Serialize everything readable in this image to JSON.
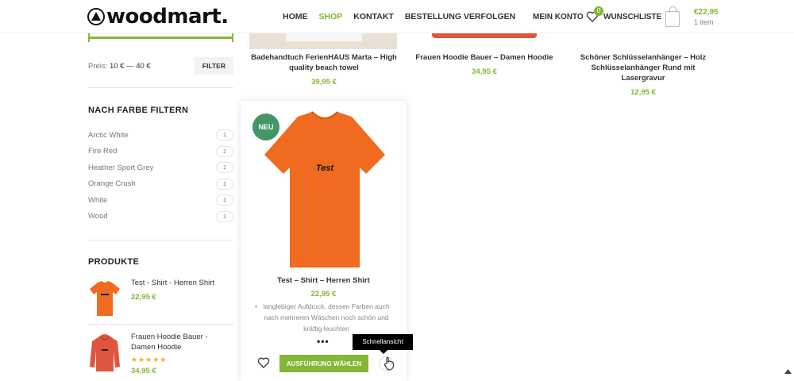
{
  "header": {
    "logo_text": "woodmart.",
    "nav": [
      "HOME",
      "SHOP",
      "KONTAKT",
      "BESTELLUNG VERFOLGEN"
    ],
    "active_nav": "SHOP",
    "my_account": "MEIN KONTO",
    "wishlist_count": "0",
    "wishlist_label": "WUNSCHLISTE",
    "cart_total": "€22,95",
    "cart_items": "1 item"
  },
  "sidebar": {
    "price_prefix": "Preis:",
    "price_range": "10 € — 40 €",
    "filter_button": "FILTER",
    "color_heading": "NACH FARBE FILTERN",
    "colors": [
      {
        "name": "Arctic White",
        "count": "1"
      },
      {
        "name": "Fire Red",
        "count": "1"
      },
      {
        "name": "Heather Sport Grey",
        "count": "1"
      },
      {
        "name": "Orange Crush",
        "count": "1"
      },
      {
        "name": "White",
        "count": "1"
      },
      {
        "name": "Wood",
        "count": "1"
      }
    ],
    "products_heading": "PRODUKTE",
    "products": [
      {
        "title": "Test - Shirt - Herren Shirt",
        "price": "22,95 €"
      },
      {
        "title": "Frauen Hoodie Bauer - Damen Hoodie",
        "price": "34,95 €",
        "stars": "★★★★★"
      }
    ]
  },
  "top_products": [
    {
      "title": "Badehandtuch FerienHAUS Marta – High quality beach towel",
      "price": "39,95 €"
    },
    {
      "title": "Frauen Hoodie Bauer – Damen Hoodie",
      "price": "34,95 €"
    },
    {
      "title": "Schöner Schlüsselanhänger – Holz Schlüsselanhänger Rund mit Lasergravur",
      "price": "12,95 €"
    }
  ],
  "featured": {
    "badge": "NEU",
    "shirt_print": "Test",
    "title": "Test – Shirt – Herren Shirt",
    "price": "22,95 €",
    "description": "langlebiger Aufdruck, dessen Farben auch nach mehreren Wäschen noch schön und kräftig leuchten",
    "dots": "•••",
    "add_button": "AUSFÜHRUNG WÄHLEN",
    "tooltip": "Schnellansicht"
  },
  "colors": {
    "accent": "#83b735",
    "badge": "#439665",
    "shirt": "#f06a1f",
    "hoodie": "#e0553f"
  }
}
